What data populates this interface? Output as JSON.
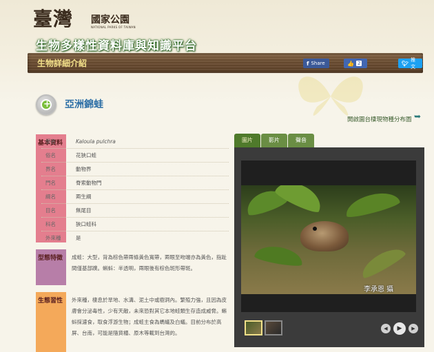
{
  "header": {
    "logo_main": "臺灣",
    "logo_side": "國家公園",
    "logo_sub": "NATIONAL PARKS OF TAIWAN",
    "site_title": "生物多樣性資料庫與知識平台",
    "section_label": "生物詳細介紹"
  },
  "social": {
    "fb_share_label": "Share",
    "fb_like_count": "2",
    "tweet_label": "推文"
  },
  "species": {
    "name": "亞洲錦蛙",
    "distribution_link": "開啟園台棲現物種分布圖"
  },
  "basic": {
    "category": "基本資料",
    "rows": [
      {
        "key": "學名",
        "value": "Kaloula pulchra"
      },
      {
        "key": "俗名",
        "value": "花狹口蛙"
      },
      {
        "key": "界名",
        "value": "動物界"
      },
      {
        "key": "門名",
        "value": "脊索動物門"
      },
      {
        "key": "綱名",
        "value": "兩生綱"
      },
      {
        "key": "目名",
        "value": "無尾目"
      },
      {
        "key": "科名",
        "value": "狹口蛙科"
      },
      {
        "key": "外來種",
        "value": "是"
      }
    ]
  },
  "morphology": {
    "category": "型態特徵",
    "text": "成蛙：大型，背為棕色帶兩條黃色寬帶，兩眼至吻端亦為黃色，指趾間僅基部蹼。蝌蚪：半透明，兩眼後有棕色斑形帶斑。"
  },
  "ecology": {
    "category": "生態習性",
    "text": "外來種，棲息於旱地、水溝、泥土中或樹洞內。繁殖力強，且因為皮膚會分泌毒性，少有天敵，未來恐對其它本地蛙類生存造成威脅。蝌蚪採濾食，取食浮游生物；成蛙主食為螞蟻及白蟻。目前分布於高屏、台南，可能是隨貨櫃、原木等載到台灣的。"
  },
  "media": {
    "tabs": [
      "圖片",
      "影片",
      "聲音"
    ],
    "photographer": "李承恩 攝"
  }
}
